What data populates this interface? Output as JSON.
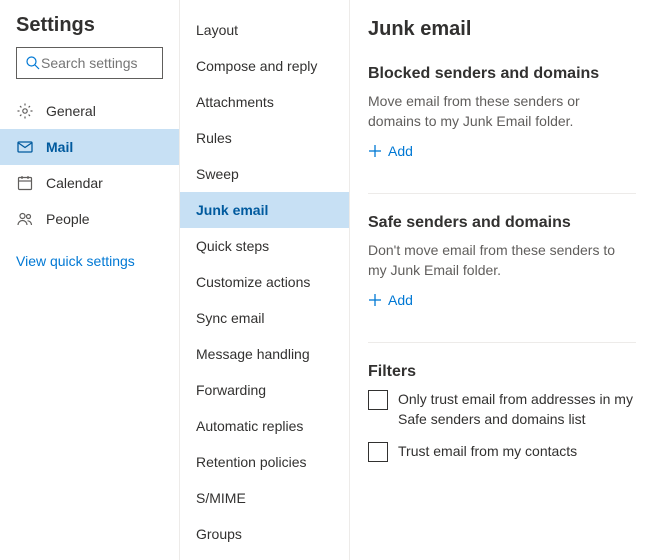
{
  "settings": {
    "title": "Settings",
    "searchPlaceholder": "Search settings",
    "quickLink": "View quick settings"
  },
  "categories": [
    {
      "icon": "gear",
      "label": "General",
      "selected": false
    },
    {
      "icon": "mail",
      "label": "Mail",
      "selected": true
    },
    {
      "icon": "calendar",
      "label": "Calendar",
      "selected": false
    },
    {
      "icon": "people",
      "label": "People",
      "selected": false
    }
  ],
  "subnav": [
    {
      "label": "Layout",
      "selected": false
    },
    {
      "label": "Compose and reply",
      "selected": false
    },
    {
      "label": "Attachments",
      "selected": false
    },
    {
      "label": "Rules",
      "selected": false
    },
    {
      "label": "Sweep",
      "selected": false
    },
    {
      "label": "Junk email",
      "selected": true
    },
    {
      "label": "Quick steps",
      "selected": false
    },
    {
      "label": "Customize actions",
      "selected": false
    },
    {
      "label": "Sync email",
      "selected": false
    },
    {
      "label": "Message handling",
      "selected": false
    },
    {
      "label": "Forwarding",
      "selected": false
    },
    {
      "label": "Automatic replies",
      "selected": false
    },
    {
      "label": "Retention policies",
      "selected": false
    },
    {
      "label": "S/MIME",
      "selected": false
    },
    {
      "label": "Groups",
      "selected": false
    }
  ],
  "page": {
    "title": "Junk email",
    "blocked": {
      "title": "Blocked senders and domains",
      "desc": "Move email from these senders or domains to my Junk Email folder.",
      "add": "Add"
    },
    "safe": {
      "title": "Safe senders and domains",
      "desc": "Don't move email from these senders to my Junk Email folder.",
      "add": "Add"
    },
    "filters": {
      "title": "Filters",
      "opt1": "Only trust email from addresses in my Safe senders and domains list",
      "opt2": "Trust email from my contacts"
    }
  }
}
